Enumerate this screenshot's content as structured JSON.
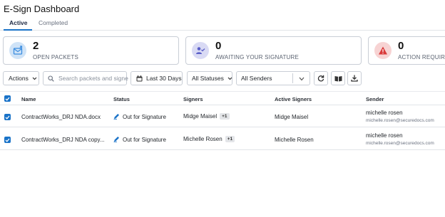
{
  "header": {
    "title": "E-Sign Dashboard"
  },
  "tabs": [
    {
      "label": "Active",
      "active": true
    },
    {
      "label": "Completed",
      "active": false
    }
  ],
  "cards": [
    {
      "count": "2",
      "label": "OPEN PACKETS",
      "icon": "envelope-arrow-icon",
      "color": "#3b8de0"
    },
    {
      "count": "0",
      "label": "AWAITING YOUR SIGNATURE",
      "icon": "user-check-icon",
      "color": "#5a5fc8"
    },
    {
      "count": "0",
      "label": "ACTION REQUIRED",
      "icon": "warning-icon",
      "color": "#d93a3a"
    }
  ],
  "toolbar": {
    "actions_label": "Actions",
    "search_placeholder": "Search packets and signe",
    "date_label": "Last 30 Days",
    "status_label": "All Statuses",
    "sender_label": "All Senders"
  },
  "table": {
    "columns": [
      "Name",
      "Status",
      "Signers",
      "Active Signers",
      "Sender"
    ],
    "rows": [
      {
        "name": "ContractWorks_DRJ NDA.docx",
        "status": "Out for Signature",
        "signer": "Midge Maisel",
        "signer_extra": "+1",
        "active_signer": "Midge Maisel",
        "sender_name": "michelle rosen",
        "sender_email": "michelle.rosen@securedocs.com"
      },
      {
        "name": "ContractWorks_DRJ NDA copy...",
        "status": "Out for Signature",
        "signer": "Michelle Rosen",
        "signer_extra": "+1",
        "active_signer": "Michelle Rosen",
        "sender_name": "michelle rosen",
        "sender_email": "michelle.rosen@securedocs.com"
      }
    ]
  },
  "colors": {
    "accent": "#1a73c8",
    "pen": "#1a73c8"
  }
}
